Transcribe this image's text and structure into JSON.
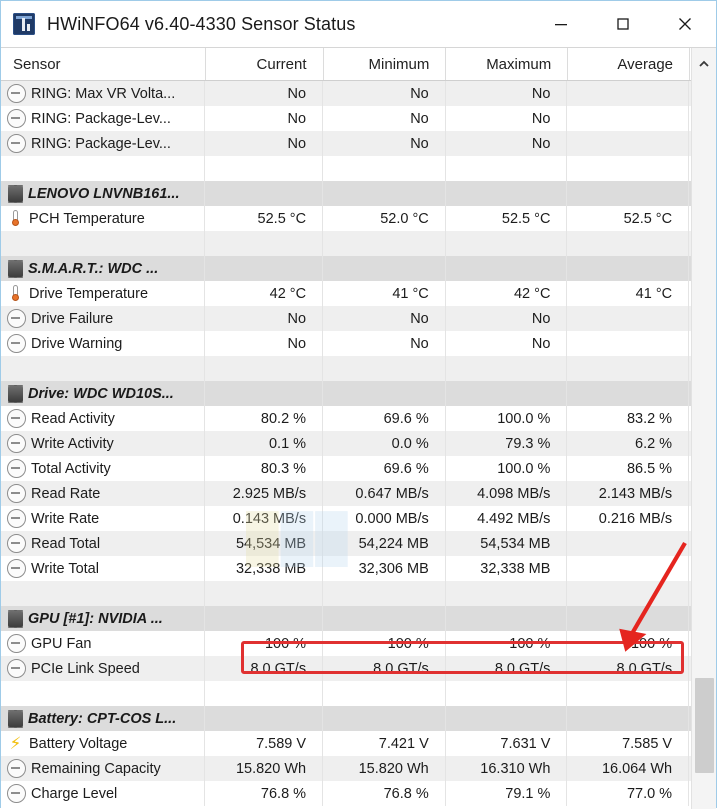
{
  "window": {
    "title": "HWiNFO64 v6.40-4330 Sensor Status",
    "icon": "hwinfo-app-icon",
    "controls": {
      "minimize": "minimize-icon",
      "maximize": "maximize-icon",
      "close": "close-icon"
    }
  },
  "table": {
    "columns": [
      "Sensor",
      "Current",
      "Minimum",
      "Maximum",
      "Average"
    ],
    "sort_indicator": "chevron-up-icon",
    "rows": [
      {
        "type": "data",
        "icon": "gauge-icon",
        "shade": "shade",
        "label": "RING: Max VR Volta...",
        "current": "No",
        "minimum": "No",
        "maximum": "No",
        "average": ""
      },
      {
        "type": "data",
        "icon": "gauge-icon",
        "shade": "plain",
        "label": "RING: Package-Lev...",
        "current": "No",
        "minimum": "No",
        "maximum": "No",
        "average": ""
      },
      {
        "type": "data",
        "icon": "gauge-icon",
        "shade": "shade",
        "label": "RING: Package-Lev...",
        "current": "No",
        "minimum": "No",
        "maximum": "No",
        "average": ""
      },
      {
        "type": "spacer",
        "shade": "plain"
      },
      {
        "type": "group",
        "icon": "chip-icon",
        "label": "LENOVO LNVNB161..."
      },
      {
        "type": "data",
        "icon": "thermometer-icon",
        "shade": "plain",
        "label": "PCH Temperature",
        "current": "52.5 °C",
        "minimum": "52.0 °C",
        "maximum": "52.5 °C",
        "average": "52.5 °C"
      },
      {
        "type": "spacer",
        "shade": "shade"
      },
      {
        "type": "group",
        "icon": "chip-icon",
        "label": "S.M.A.R.T.: WDC ..."
      },
      {
        "type": "data",
        "icon": "thermometer-icon",
        "shade": "plain",
        "label": "Drive Temperature",
        "current": "42 °C",
        "minimum": "41 °C",
        "maximum": "42 °C",
        "average": "41 °C"
      },
      {
        "type": "data",
        "icon": "gauge-icon",
        "shade": "shade",
        "label": "Drive Failure",
        "current": "No",
        "minimum": "No",
        "maximum": "No",
        "average": ""
      },
      {
        "type": "data",
        "icon": "gauge-icon",
        "shade": "plain",
        "label": "Drive Warning",
        "current": "No",
        "minimum": "No",
        "maximum": "No",
        "average": ""
      },
      {
        "type": "spacer",
        "shade": "shade"
      },
      {
        "type": "group",
        "icon": "chip-icon",
        "label": "Drive: WDC WD10S..."
      },
      {
        "type": "data",
        "icon": "gauge-icon",
        "shade": "plain",
        "label": "Read Activity",
        "current": "80.2 %",
        "minimum": "69.6 %",
        "maximum": "100.0 %",
        "average": "83.2 %"
      },
      {
        "type": "data",
        "icon": "gauge-icon",
        "shade": "shade",
        "label": "Write Activity",
        "current": "0.1 %",
        "minimum": "0.0 %",
        "maximum": "79.3 %",
        "average": "6.2 %"
      },
      {
        "type": "data",
        "icon": "gauge-icon",
        "shade": "plain",
        "label": "Total Activity",
        "current": "80.3 %",
        "minimum": "69.6 %",
        "maximum": "100.0 %",
        "average": "86.5 %"
      },
      {
        "type": "data",
        "icon": "gauge-icon",
        "shade": "shade",
        "label": "Read Rate",
        "current": "2.925 MB/s",
        "minimum": "0.647 MB/s",
        "maximum": "4.098 MB/s",
        "average": "2.143 MB/s"
      },
      {
        "type": "data",
        "icon": "gauge-icon",
        "shade": "plain",
        "label": "Write Rate",
        "current": "0.143 MB/s",
        "minimum": "0.000 MB/s",
        "maximum": "4.492 MB/s",
        "average": "0.216 MB/s"
      },
      {
        "type": "data",
        "icon": "gauge-icon",
        "shade": "shade",
        "label": "Read Total",
        "current": "54,534 MB",
        "minimum": "54,224 MB",
        "maximum": "54,534 MB",
        "average": ""
      },
      {
        "type": "data",
        "icon": "gauge-icon",
        "shade": "plain",
        "label": "Write Total",
        "current": "32,338 MB",
        "minimum": "32,306 MB",
        "maximum": "32,338 MB",
        "average": ""
      },
      {
        "type": "spacer",
        "shade": "shade"
      },
      {
        "type": "group",
        "icon": "chip-icon",
        "label": "GPU [#1]: NVIDIA ..."
      },
      {
        "type": "data",
        "icon": "gauge-icon",
        "shade": "plain",
        "label": "GPU Fan",
        "current": "100 %",
        "minimum": "100 %",
        "maximum": "100 %",
        "average": "100 %"
      },
      {
        "type": "data",
        "icon": "gauge-icon",
        "shade": "shade",
        "label": "PCIe Link Speed",
        "current": "8.0 GT/s",
        "minimum": "8.0 GT/s",
        "maximum": "8.0 GT/s",
        "average": "8.0 GT/s"
      },
      {
        "type": "spacer",
        "shade": "plain"
      },
      {
        "type": "group",
        "icon": "chip-icon",
        "label": "Battery: CPT-COS L..."
      },
      {
        "type": "data",
        "icon": "bolt-icon",
        "shade": "plain",
        "label": "Battery Voltage",
        "current": "7.589 V",
        "minimum": "7.421 V",
        "maximum": "7.631 V",
        "average": "7.585 V"
      },
      {
        "type": "data",
        "icon": "gauge-icon",
        "shade": "shade",
        "label": "Remaining Capacity",
        "current": "15.820 Wh",
        "minimum": "15.820 Wh",
        "maximum": "16.310 Wh",
        "average": "16.064 Wh"
      },
      {
        "type": "data",
        "icon": "gauge-icon",
        "shade": "plain",
        "label": "Charge Level",
        "current": "76.8 %",
        "minimum": "76.8 %",
        "maximum": "79.1 %",
        "average": "77.0 %"
      }
    ]
  },
  "annotations": {
    "highlight_color": "#e03131",
    "highlight_target": "GPU Fan",
    "arrow_color": "#e03131"
  },
  "scrollbar": {
    "up_arrow": "chevron-up-icon"
  }
}
